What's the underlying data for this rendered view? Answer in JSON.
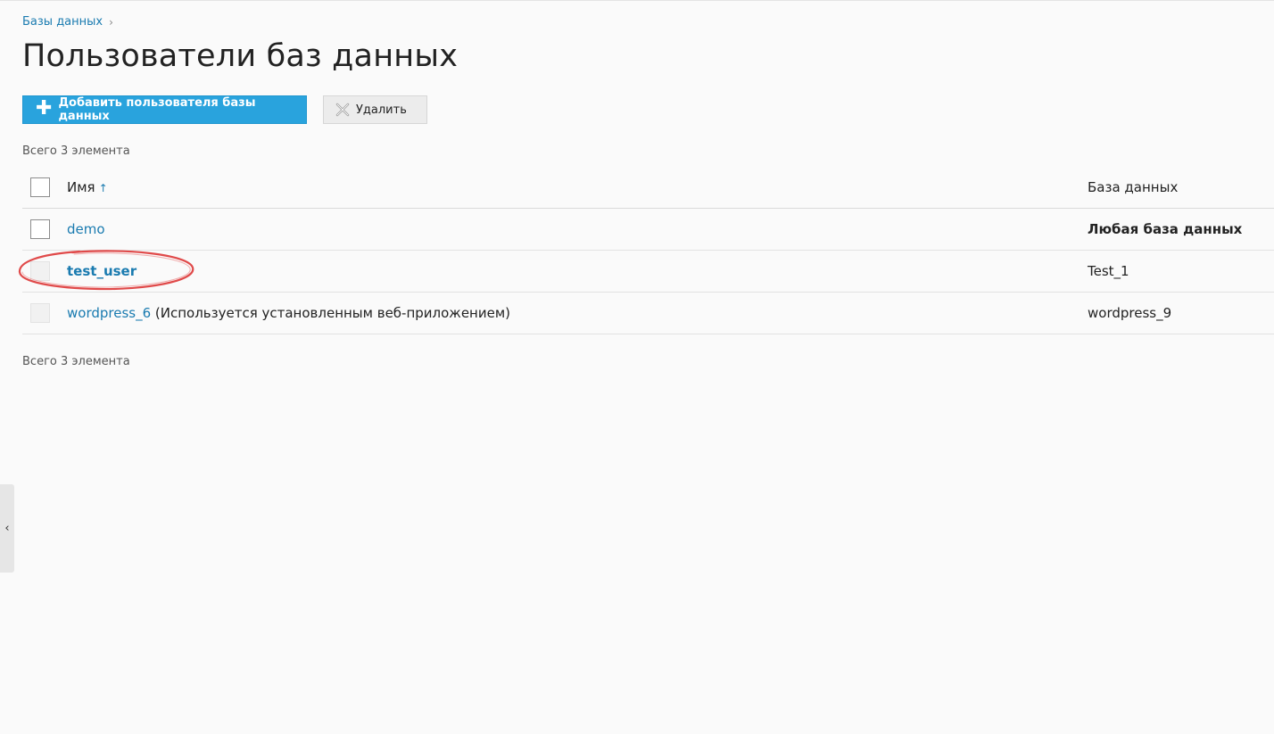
{
  "breadcrumb": {
    "items": [
      "Базы данных"
    ]
  },
  "page": {
    "title": "Пользователи баз данных"
  },
  "toolbar": {
    "add_label": "Добавить пользователя базы данных",
    "delete_label": "Удалить"
  },
  "summary": {
    "top": "Всего 3 элемента",
    "bottom": "Всего 3 элемента"
  },
  "table": {
    "columns": {
      "name": "Имя",
      "name_sort": "↑",
      "database": "База данных"
    },
    "rows": [
      {
        "name": "demo",
        "note": "",
        "database": "Любая база данных",
        "database_bold": true,
        "name_bold": false,
        "checkbox_enabled": true
      },
      {
        "name": "test_user",
        "note": "",
        "database": "Test_1",
        "database_bold": false,
        "name_bold": true,
        "checkbox_enabled": false
      },
      {
        "name": "wordpress_6",
        "note": " (Используется установленным веб-приложением)",
        "database": "wordpress_9",
        "database_bold": false,
        "name_bold": false,
        "checkbox_enabled": false
      }
    ]
  },
  "colors": {
    "accent": "#29a3dd",
    "link": "#1a7bb0",
    "annotation": "#e04a4a"
  },
  "icons": {
    "add": "plus-icon",
    "delete": "x-icon",
    "collapse": "chevron-left-icon"
  }
}
